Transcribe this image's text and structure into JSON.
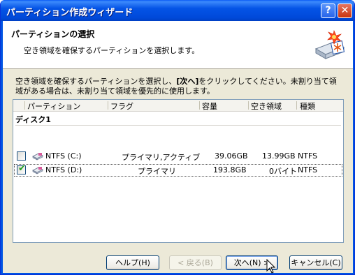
{
  "window": {
    "title": "パーティション作成ウィザード",
    "help_glyph": "?",
    "close_glyph": "✕",
    "icons": {
      "help": "help-icon",
      "close": "close-icon"
    }
  },
  "header": {
    "title": "パーティションの選択",
    "subtitle": "空き領域を確保するパーティションを選択します。",
    "icon": "wizard-disk-icon"
  },
  "instructions": {
    "before": "空き領域を確保するパーティションを選択し、",
    "button_ref": "[次へ]",
    "after": "をクリックしてください。未割り当て領域がある場合は、未割り当て領域を優先的に使用します。"
  },
  "table": {
    "columns": [
      "パーティション",
      "フラグ",
      "容量",
      "空き領域",
      "種類"
    ],
    "group_label": "ディスク1",
    "rows": [
      {
        "checked": false,
        "selected": false,
        "partition": "NTFS (C:)",
        "flags": "プライマリ,アクティブ",
        "capacity": "39.06GB",
        "free": "13.99GB",
        "type": "NTFS"
      },
      {
        "checked": true,
        "selected": true,
        "partition": "NTFS (D:)",
        "flags": "プライマリ",
        "capacity": "193.8GB",
        "free": "0バイト",
        "type": "NTFS"
      }
    ]
  },
  "buttons": {
    "help": "ヘルプ(H)",
    "back": "< 戻る(B)",
    "next": "次へ(N) >",
    "cancel": "キャンセル(C)"
  },
  "colors": {
    "titlebar": "#0054e3",
    "dialog_bg": "#ece9d8",
    "check_green": "#21a121"
  }
}
